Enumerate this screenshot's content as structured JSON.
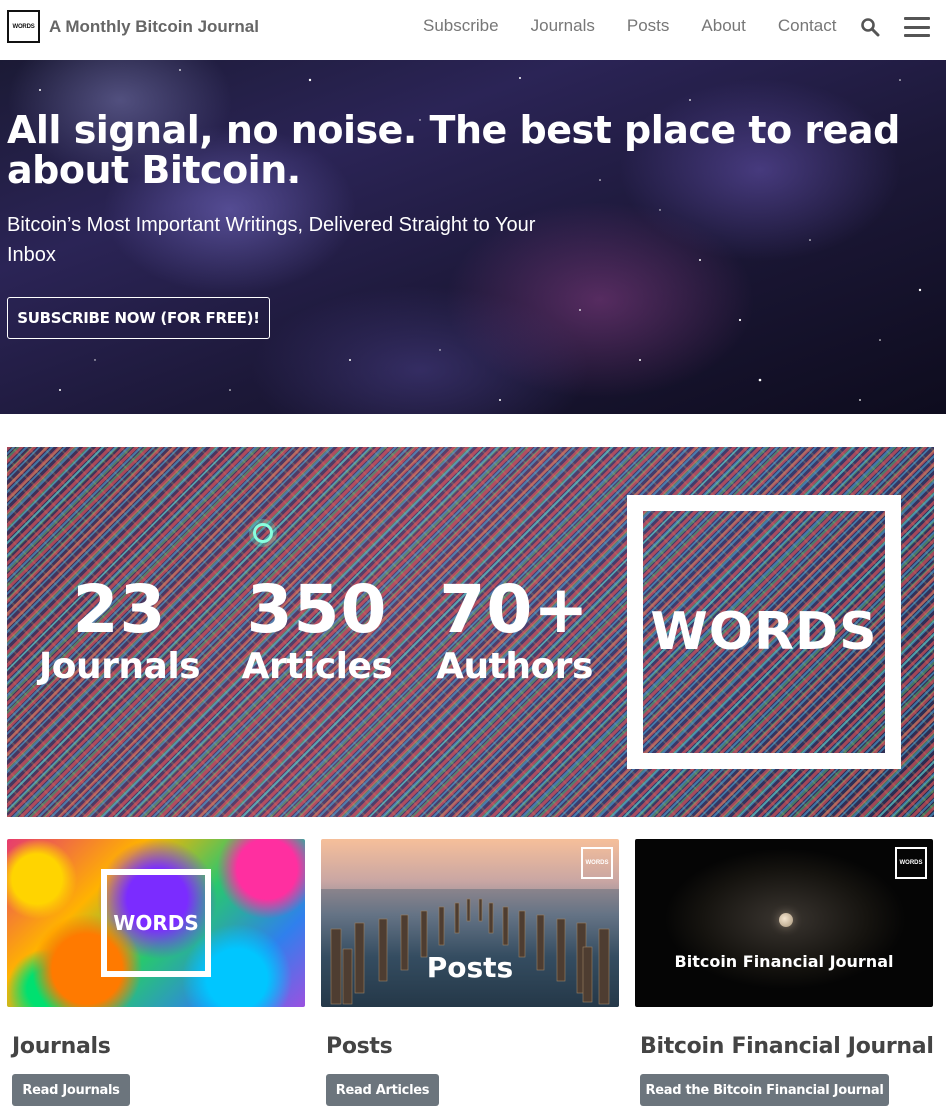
{
  "nav": {
    "logo_text": "WORDS",
    "brand_name": "A Monthly Bitcoin Journal",
    "links": [
      {
        "label": "Subscribe"
      },
      {
        "label": "Journals"
      },
      {
        "label": "Posts"
      },
      {
        "label": "About"
      },
      {
        "label": "Contact"
      }
    ],
    "search_icon": "search-icon",
    "menu_icon": "hamburger-menu-icon"
  },
  "hero": {
    "title": "All signal, no noise. The best place to read about Bitcoin.",
    "subtitle": "Bitcoin’s Most Important Writings, Delivered Straight to Your Inbox",
    "cta_label": "SUBSCRIBE NOW (FOR FREE)!"
  },
  "stats": {
    "items": [
      {
        "number": "23",
        "label": "Journals"
      },
      {
        "number": "350",
        "label": "Articles"
      },
      {
        "number": "70+",
        "label": "Authors"
      }
    ],
    "logo_text": "WORDS"
  },
  "cards": [
    {
      "image_text": "WORDS",
      "title": "Journals",
      "button": "Read Journals"
    },
    {
      "image_text": "Posts",
      "logo_text": "WORDS",
      "title": "Posts",
      "button": "Read Articles"
    },
    {
      "image_text": "Bitcoin Financial Journal",
      "logo_text": "WORDS",
      "title": "Bitcoin Financial Journal",
      "button": "Read the Bitcoin Financial Journal"
    }
  ],
  "colors": {
    "button_gray": "#6c757d",
    "nav_text": "#777777",
    "brand_text": "#666666"
  }
}
